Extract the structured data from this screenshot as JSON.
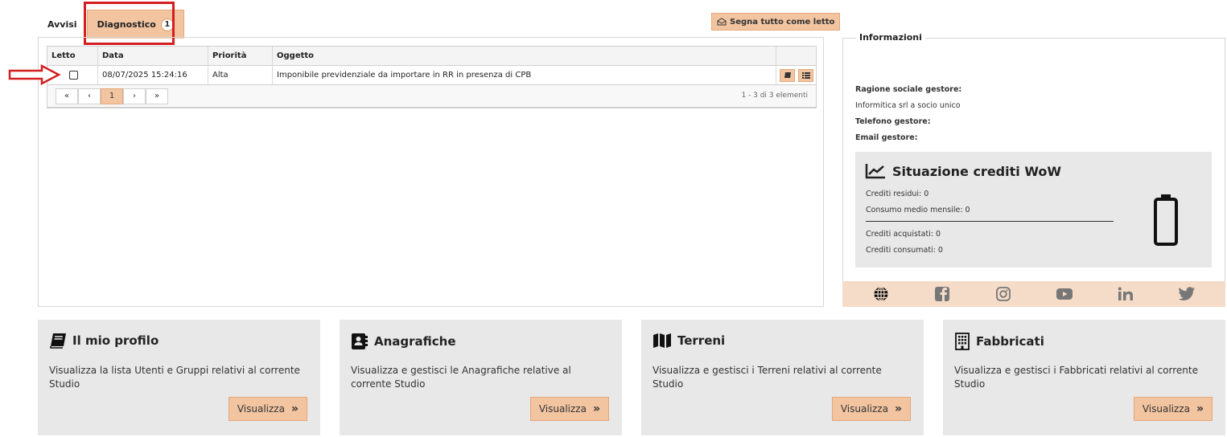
{
  "tabs": [
    {
      "label": "Avvisi"
    },
    {
      "label": "Diagnostico",
      "badge": "1"
    }
  ],
  "toolbar": {
    "mark_all_label": "Segna tutto come letto"
  },
  "grid": {
    "headers": [
      "Letto",
      "Data",
      "Priorità",
      "Oggetto"
    ],
    "rows": [
      {
        "data": "08/07/2025 15:24:16",
        "priorita": "Alta",
        "oggetto": "Imponibile previdenziale da importare in RR in presenza di CPB"
      }
    ],
    "pager": {
      "first": "«",
      "prev": "‹",
      "current": "1",
      "next": "›",
      "last": "»",
      "info": "1 - 3 di 3 elementi"
    }
  },
  "info": {
    "legend": "Informazioni",
    "ragione_label": "Ragione sociale gestore:",
    "ragione_value": "Informitica srl a socio unico",
    "telefono_label": "Telefono gestore:",
    "email_label": "Email gestore:"
  },
  "credits": {
    "title": "Situazione crediti WoW",
    "residui": "Crediti residui: 0",
    "consumo": "Consumo medio mensile: 0",
    "acquistati": "Crediti acquistati: 0",
    "consumati": "Crediti consumati: 0"
  },
  "social": [
    "globe-icon",
    "facebook-icon",
    "instagram-icon",
    "youtube-icon",
    "linkedin-icon",
    "twitter-icon"
  ],
  "cards": [
    {
      "title": "Il mio profilo",
      "desc": "Visualizza la lista Utenti e Gruppi relativi al corrente Studio",
      "button": "Visualizza"
    },
    {
      "title": "Anagrafiche",
      "desc": "Visualizza e gestisci le Anagrafiche relative al corrente Studio",
      "button": "Visualizza"
    },
    {
      "title": "Terreni",
      "desc": "Visualizza e gestisci i Terreni relativi al corrente Studio",
      "button": "Visualizza"
    },
    {
      "title": "Fabbricati",
      "desc": "Visualizza e gestisci i Fabbricati relativi al corrente Studio",
      "button": "Visualizza"
    }
  ],
  "colors": {
    "accent": "#f2c4a0",
    "highlight": "#d31f1f",
    "panel": "#e8e8e8"
  }
}
